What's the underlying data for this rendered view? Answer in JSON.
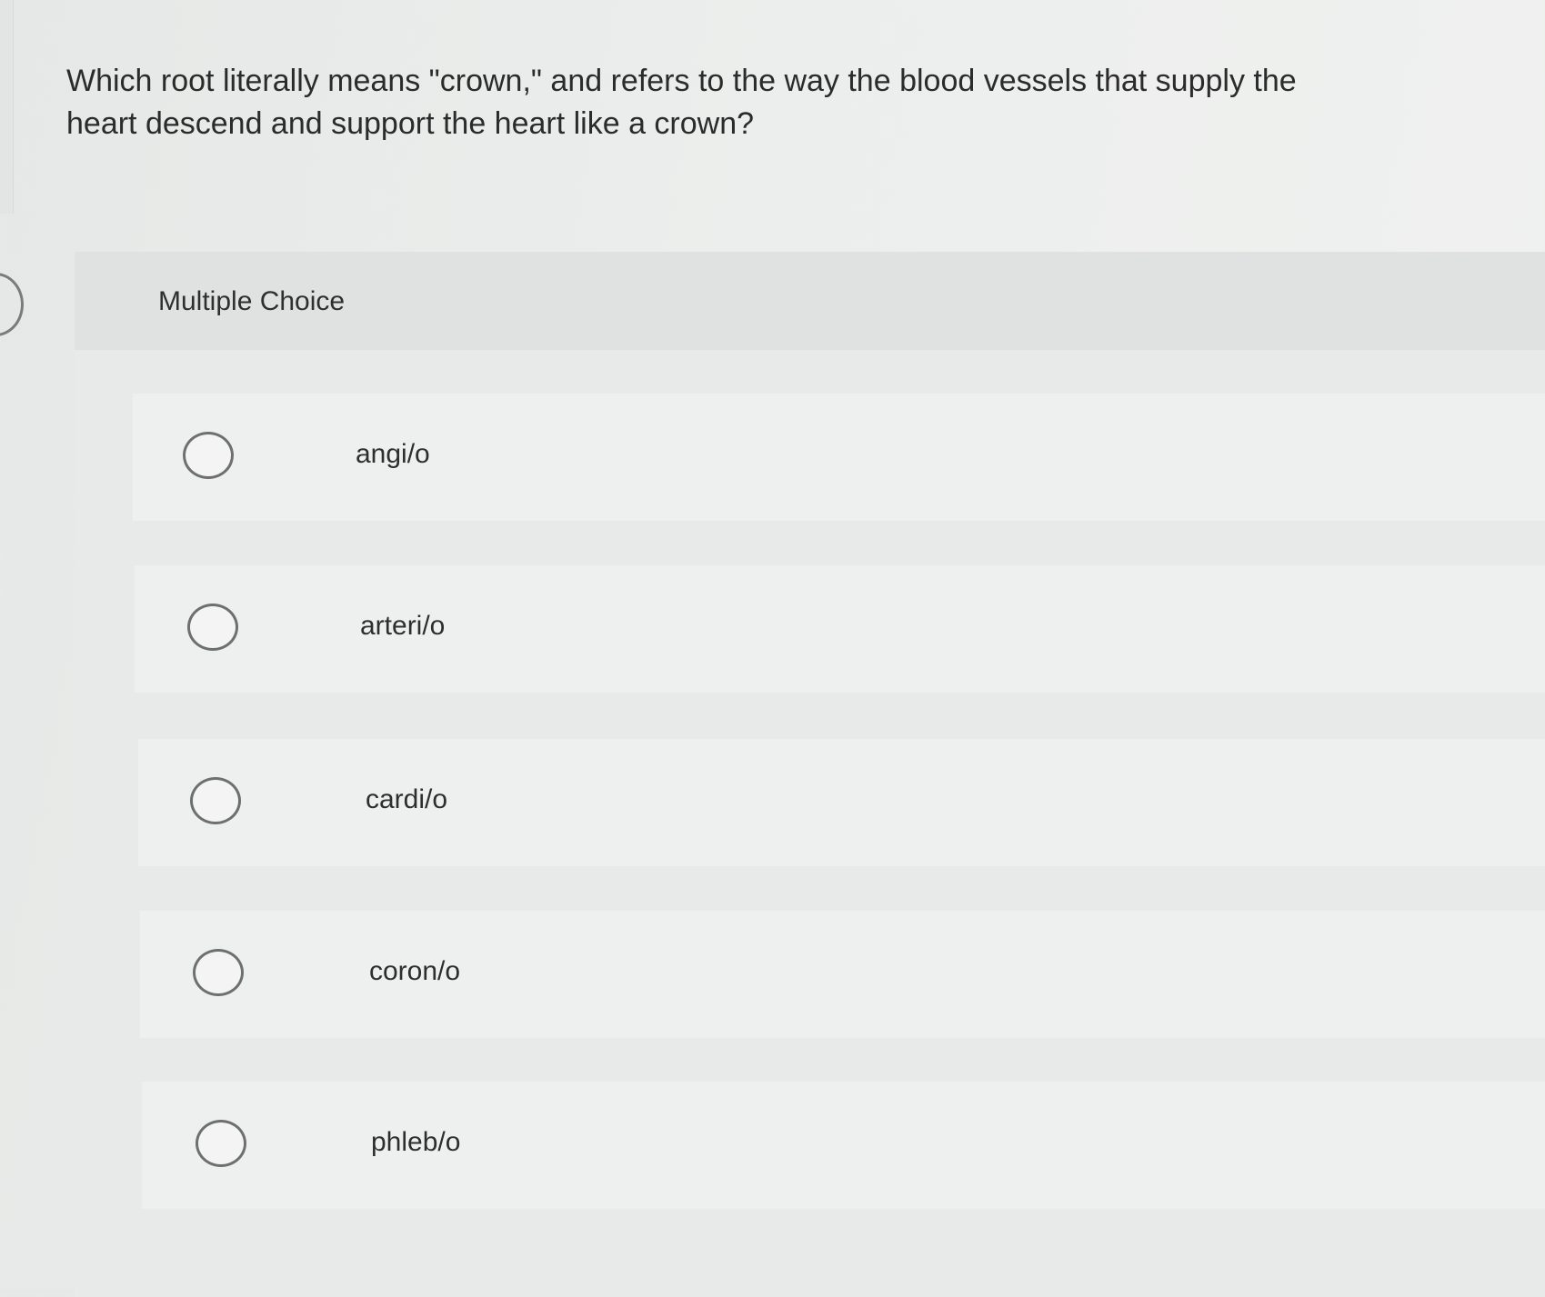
{
  "question": {
    "text": "Which root literally means \"crown,\" and refers to the way the blood vessels that supply the heart descend and support the heart like a crown?"
  },
  "multiple_choice": {
    "title": "Multiple Choice",
    "options": [
      {
        "label": "angi/o",
        "selected": false
      },
      {
        "label": "arteri/o",
        "selected": false
      },
      {
        "label": "cardi/o",
        "selected": false
      },
      {
        "label": "coron/o",
        "selected": false
      },
      {
        "label": "phleb/o",
        "selected": false
      }
    ]
  },
  "colors": {
    "background": "#eceeed",
    "panel": "#e2e4e3",
    "option_row": "#eef0ef",
    "radio_border": "#6e7070",
    "text": "#2b2b2b"
  }
}
